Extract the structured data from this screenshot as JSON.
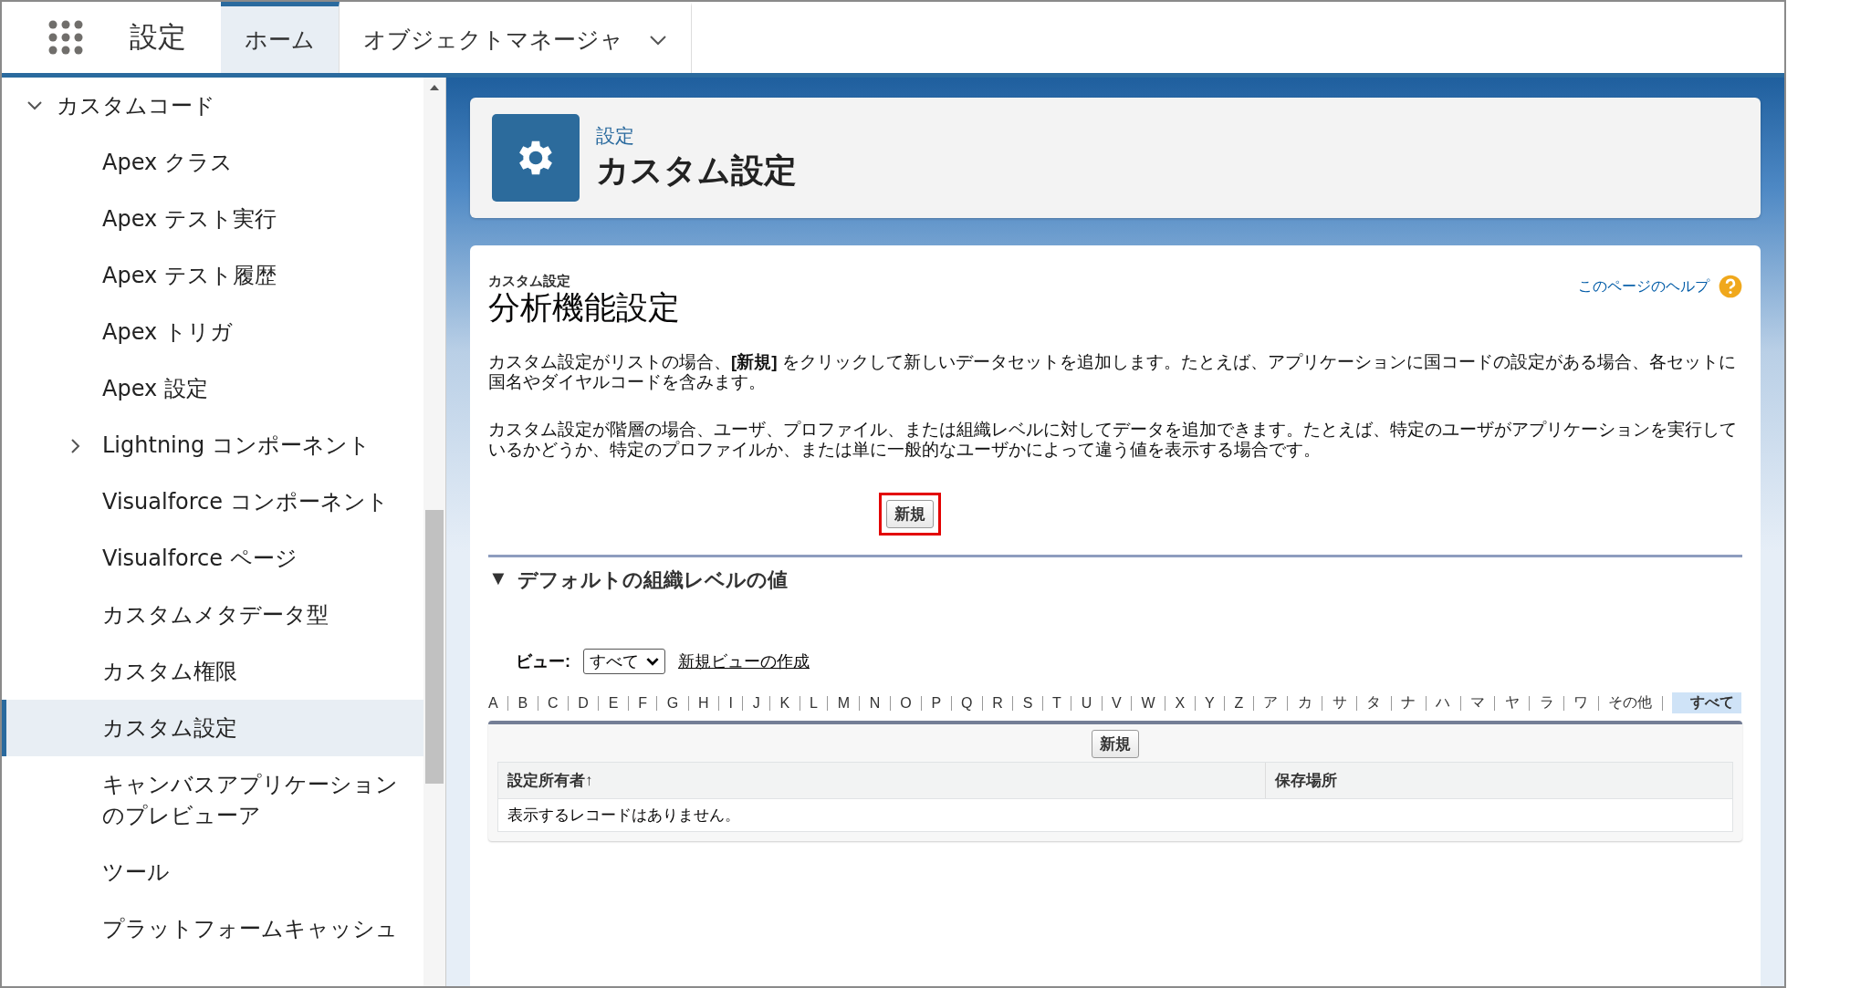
{
  "header": {
    "app_name": "設定",
    "tabs": [
      {
        "label": "ホーム",
        "selected": true,
        "dropdown": false
      },
      {
        "label": "オブジェクトマネージャ",
        "selected": false,
        "dropdown": true
      }
    ]
  },
  "sidebar": {
    "items": [
      {
        "label": "カスタムコード",
        "expanded": true,
        "selected": false,
        "children": [
          {
            "label": "Apex クラス",
            "selected": false
          },
          {
            "label": "Apex テスト実行",
            "selected": false
          },
          {
            "label": "Apex テスト履歴",
            "selected": false
          },
          {
            "label": "Apex トリガ",
            "selected": false
          },
          {
            "label": "Apex 設定",
            "selected": false
          },
          {
            "label": "Lightning コンポーネント",
            "selected": false,
            "expanded": false
          },
          {
            "label": "Visualforce コンポーネント",
            "selected": false
          },
          {
            "label": "Visualforce ページ",
            "selected": false
          },
          {
            "label": "カスタムメタデータ型",
            "selected": false
          },
          {
            "label": "カスタム権限",
            "selected": false
          },
          {
            "label": "カスタム設定",
            "selected": true
          },
          {
            "label": "キャンバスアプリケーションのプレビューア",
            "selected": false
          },
          {
            "label": "ツール",
            "selected": false
          },
          {
            "label": "プラットフォームキャッシュ",
            "selected": false
          }
        ]
      }
    ]
  },
  "page_header": {
    "breadcrumb": "設定",
    "title": "カスタム設定"
  },
  "content": {
    "subtitle": "カスタム設定",
    "title": "分析機能設定",
    "help_link": "このページのヘルプ",
    "paragraphs": [
      "カスタム設定がリストの場合、**[新規]** をクリックして新しいデータセットを追加します。たとえば、アプリケーションに国コードの設定がある場合、各セットに国名やダイヤルコードを含みます。",
      "カスタム設定が階層の場合、ユーザ、プロファイル、または組織レベルに対してデータを追加できます。たとえば、特定のユーザがアプリケーションを実行しているかどうか、特定のプロファイルか、または単に一般的なユーザかによって違う値を表示する場合です。"
    ],
    "new_button": {
      "label": "新規",
      "highlighted": true
    },
    "section": {
      "title": "デフォルトの組織レベルの値",
      "expanded": true,
      "toggle": "▼"
    },
    "view": {
      "label": "ビュー:",
      "value": "すべて",
      "create_link": "新規ビューの作成"
    },
    "alpha_filter": [
      {
        "label": "A",
        "selected": false
      },
      {
        "label": "B",
        "selected": false
      },
      {
        "label": "C",
        "selected": false
      },
      {
        "label": "D",
        "selected": false
      },
      {
        "label": "E",
        "selected": false
      },
      {
        "label": "F",
        "selected": false
      },
      {
        "label": "G",
        "selected": false
      },
      {
        "label": "H",
        "selected": false
      },
      {
        "label": "I",
        "selected": false
      },
      {
        "label": "J",
        "selected": false
      },
      {
        "label": "K",
        "selected": false
      },
      {
        "label": "L",
        "selected": false
      },
      {
        "label": "M",
        "selected": false
      },
      {
        "label": "N",
        "selected": false
      },
      {
        "label": "O",
        "selected": false
      },
      {
        "label": "P",
        "selected": false
      },
      {
        "label": "Q",
        "selected": false
      },
      {
        "label": "R",
        "selected": false
      },
      {
        "label": "S",
        "selected": false
      },
      {
        "label": "T",
        "selected": false
      },
      {
        "label": "U",
        "selected": false
      },
      {
        "label": "V",
        "selected": false
      },
      {
        "label": "W",
        "selected": false
      },
      {
        "label": "X",
        "selected": false
      },
      {
        "label": "Y",
        "selected": false
      },
      {
        "label": "Z",
        "selected": false
      },
      {
        "label": "ア",
        "selected": false
      },
      {
        "label": "カ",
        "selected": false
      },
      {
        "label": "サ",
        "selected": false
      },
      {
        "label": "タ",
        "selected": false
      },
      {
        "label": "ナ",
        "selected": false
      },
      {
        "label": "ハ",
        "selected": false
      },
      {
        "label": "マ",
        "selected": false
      },
      {
        "label": "ヤ",
        "selected": false
      },
      {
        "label": "ラ",
        "selected": false
      },
      {
        "label": "ワ",
        "selected": false
      },
      {
        "label": "その他",
        "selected": false
      },
      {
        "label": "すべて",
        "selected": true
      }
    ],
    "table": {
      "button": "新規",
      "columns": [
        {
          "label": "設定所有者",
          "sort": "↑"
        },
        {
          "label": "保存場所"
        }
      ],
      "empty_message": "表示するレコードはありません。"
    }
  }
}
